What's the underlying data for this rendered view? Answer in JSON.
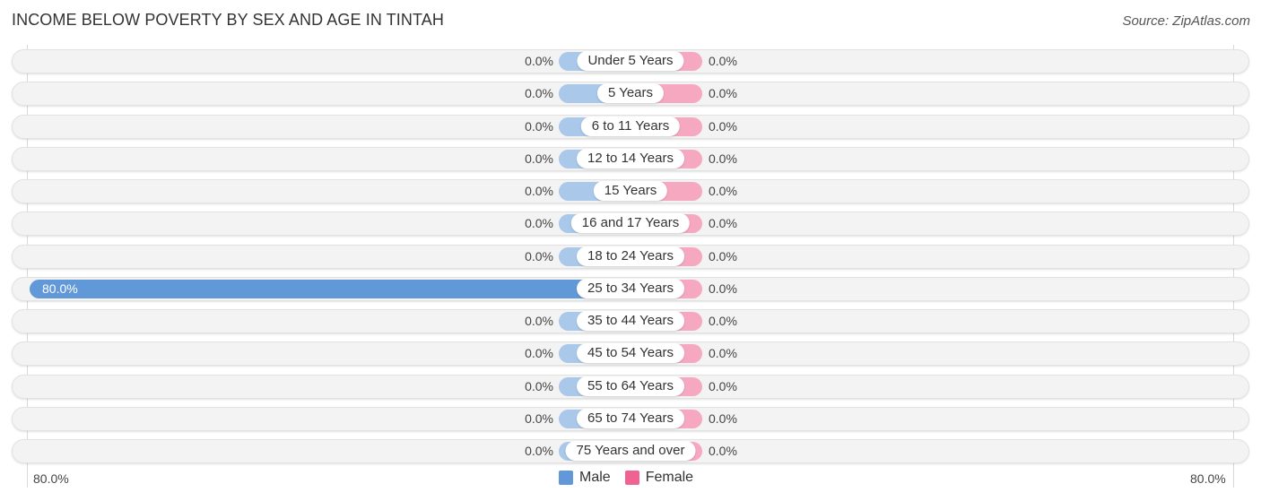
{
  "header": {
    "title": "INCOME BELOW POVERTY BY SEX AND AGE IN TINTAH",
    "source": "Source: ZipAtlas.com"
  },
  "colors": {
    "male": "#6199d8",
    "male_light": "#a9c8ea",
    "female": "#f06292",
    "female_light": "#f6a8c1"
  },
  "chart_data": {
    "type": "bar",
    "orientation": "horizontal-diverging",
    "title": "INCOME BELOW POVERTY BY SEX AND AGE IN TINTAH",
    "categories": [
      "Under 5 Years",
      "5 Years",
      "6 to 11 Years",
      "12 to 14 Years",
      "15 Years",
      "16 and 17 Years",
      "18 to 24 Years",
      "25 to 34 Years",
      "35 to 44 Years",
      "45 to 54 Years",
      "55 to 64 Years",
      "65 to 74 Years",
      "75 Years and over"
    ],
    "series": [
      {
        "name": "Male",
        "values": [
          0,
          0,
          0,
          0,
          0,
          0,
          0,
          80,
          0,
          0,
          0,
          0,
          0
        ],
        "labels": [
          "0.0%",
          "0.0%",
          "0.0%",
          "0.0%",
          "0.0%",
          "0.0%",
          "0.0%",
          "80.0%",
          "0.0%",
          "0.0%",
          "0.0%",
          "0.0%",
          "0.0%"
        ]
      },
      {
        "name": "Female",
        "values": [
          0,
          0,
          0,
          0,
          0,
          0,
          0,
          0,
          0,
          0,
          0,
          0,
          0
        ],
        "labels": [
          "0.0%",
          "0.0%",
          "0.0%",
          "0.0%",
          "0.0%",
          "0.0%",
          "0.0%",
          "0.0%",
          "0.0%",
          "0.0%",
          "0.0%",
          "0.0%",
          "0.0%"
        ]
      }
    ],
    "xlim": [
      -80,
      80
    ],
    "axis_labels": {
      "left": "80.0%",
      "right": "80.0%"
    },
    "legend": {
      "position": "bottom-center",
      "entries": [
        "Male",
        "Female"
      ]
    },
    "unit": "%"
  }
}
